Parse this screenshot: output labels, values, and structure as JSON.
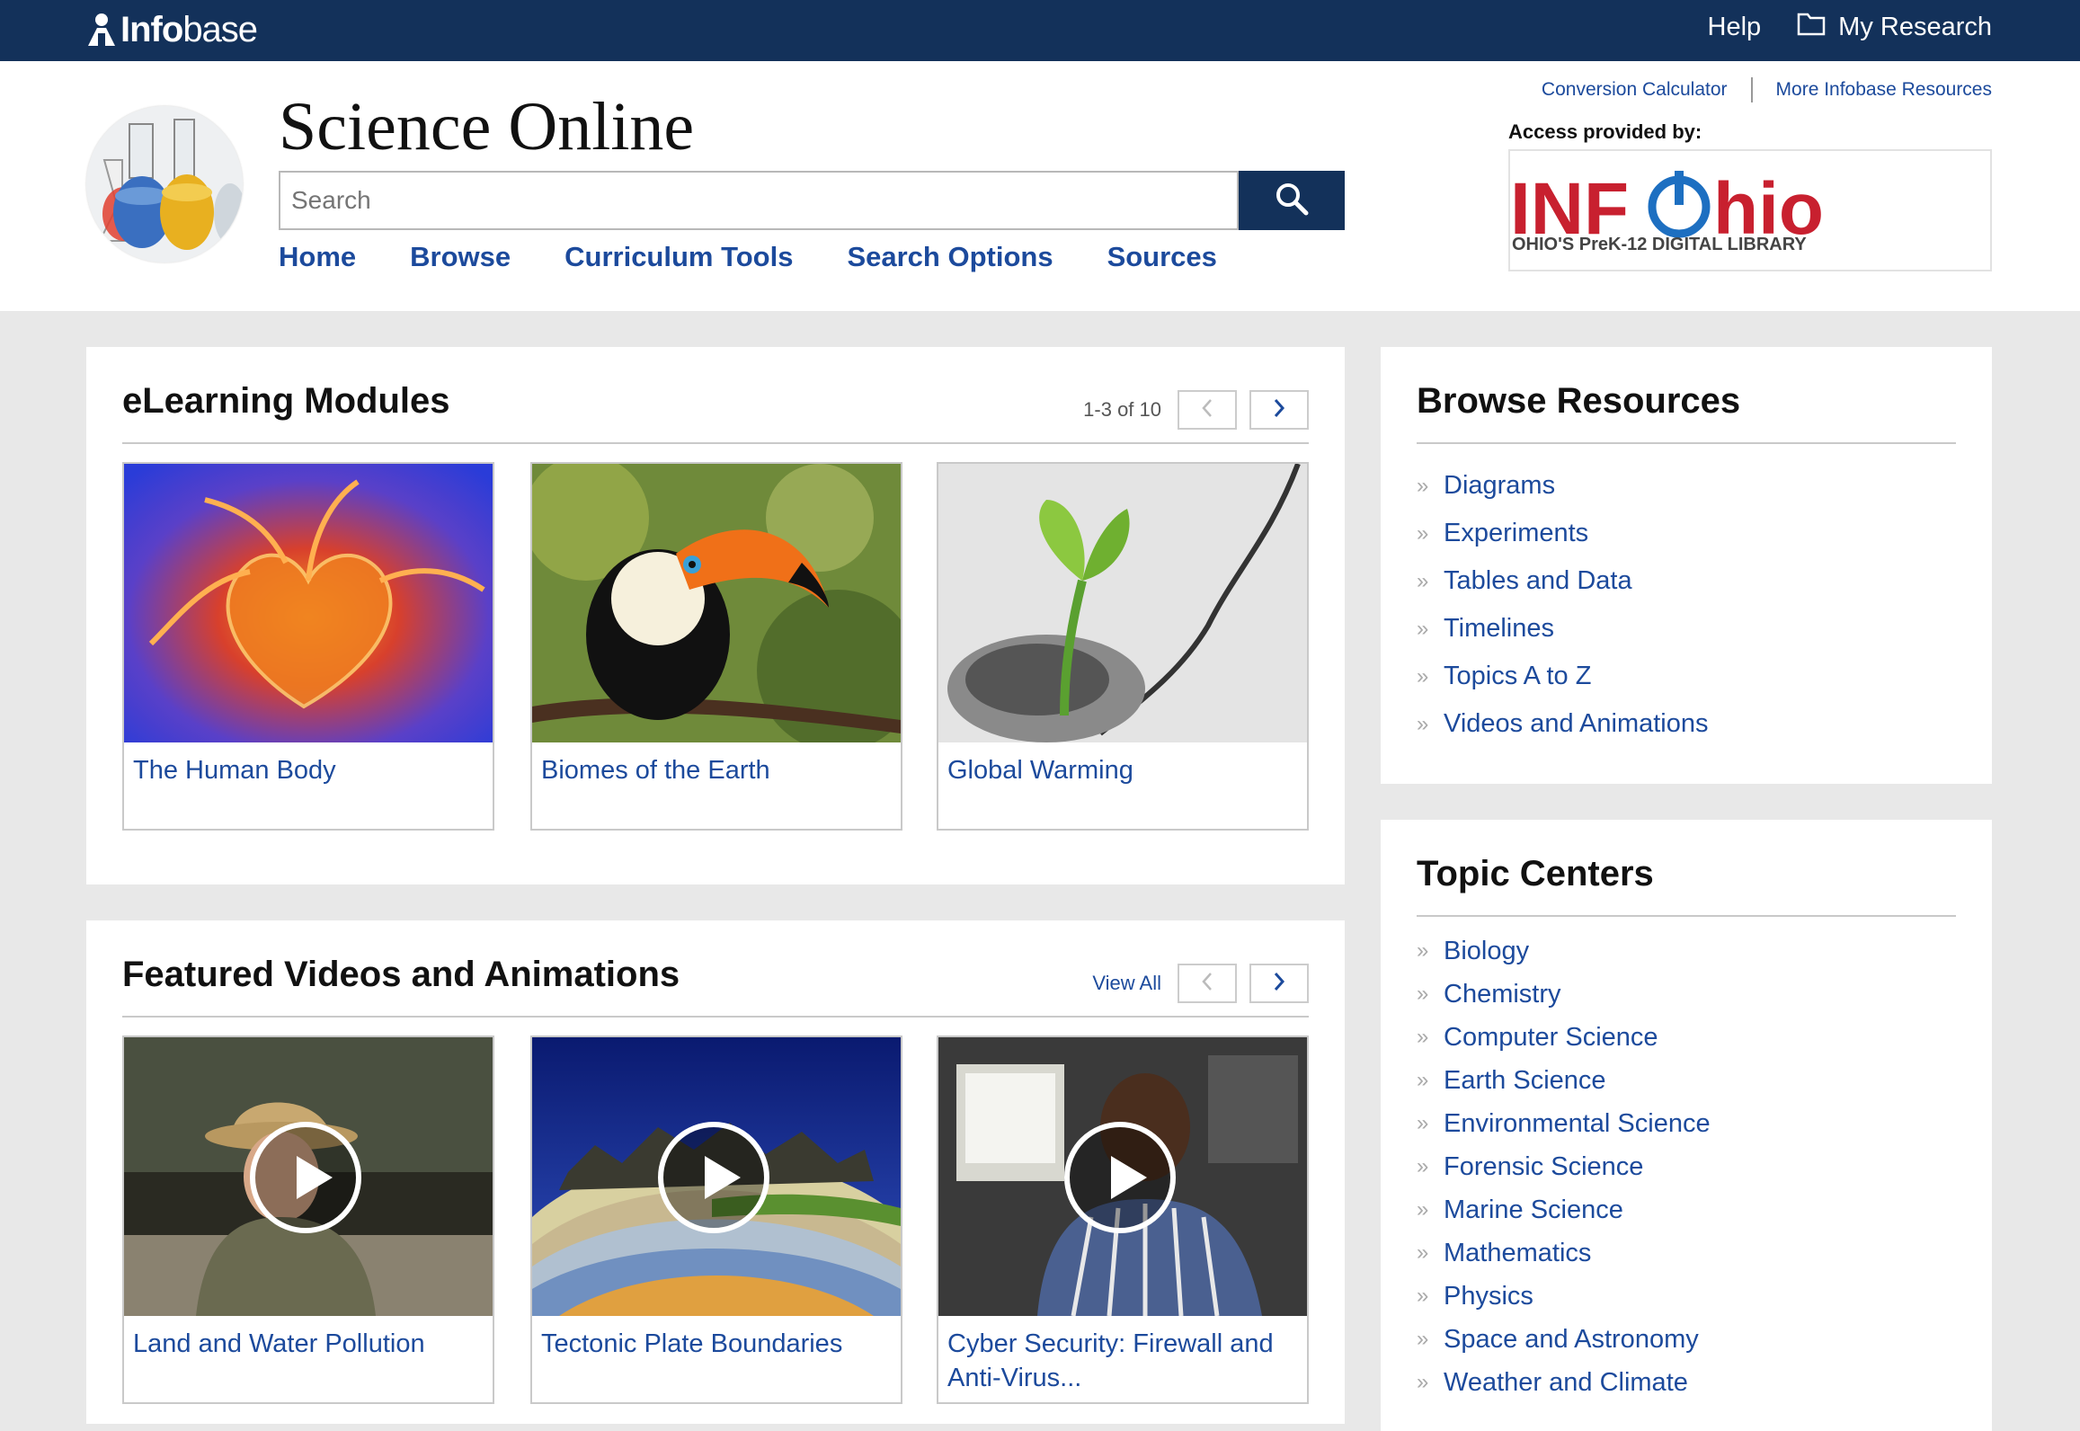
{
  "topbar": {
    "brand_bold": "Info",
    "brand_light": "base",
    "help": "Help",
    "my_research": "My Research"
  },
  "header": {
    "site_title": "Science Online",
    "search_placeholder": "Search",
    "nav": [
      "Home",
      "Browse",
      "Curriculum Tools",
      "Search Options",
      "Sources"
    ],
    "util_links": [
      "Conversion Calculator",
      "More Infobase Resources"
    ],
    "access_label": "Access provided by:",
    "sponsor_logo_text": "INFOhio",
    "sponsor_tagline": "OHIO'S PreK-12 DIGITAL LIBRARY"
  },
  "elearning": {
    "title": "eLearning Modules",
    "count": "1-3 of 10",
    "cards": [
      {
        "caption": "The Human Body"
      },
      {
        "caption": "Biomes of the Earth"
      },
      {
        "caption": "Global Warming"
      }
    ]
  },
  "videos": {
    "title": "Featured Videos and Animations",
    "view_all": "View All",
    "cards": [
      {
        "caption": "Land and Water Pollution"
      },
      {
        "caption": "Tectonic Plate Boundaries"
      },
      {
        "caption": "Cyber Security: Firewall and Anti-Virus..."
      }
    ]
  },
  "browse_resources": {
    "title": "Browse Resources",
    "items": [
      "Diagrams",
      "Experiments",
      "Tables and Data",
      "Timelines",
      "Topics A to Z",
      "Videos and Animations"
    ]
  },
  "topic_centers": {
    "title": "Topic Centers",
    "items": [
      "Biology",
      "Chemistry",
      "Computer Science",
      "Earth Science",
      "Environmental Science",
      "Forensic Science",
      "Marine Science",
      "Mathematics",
      "Physics",
      "Space and Astronomy",
      "Weather and Climate"
    ]
  },
  "colors": {
    "navy": "#13315a",
    "link_blue": "#1c4a9c",
    "infohio_red": "#c8202f",
    "infohio_blue": "#1d6fc1"
  }
}
